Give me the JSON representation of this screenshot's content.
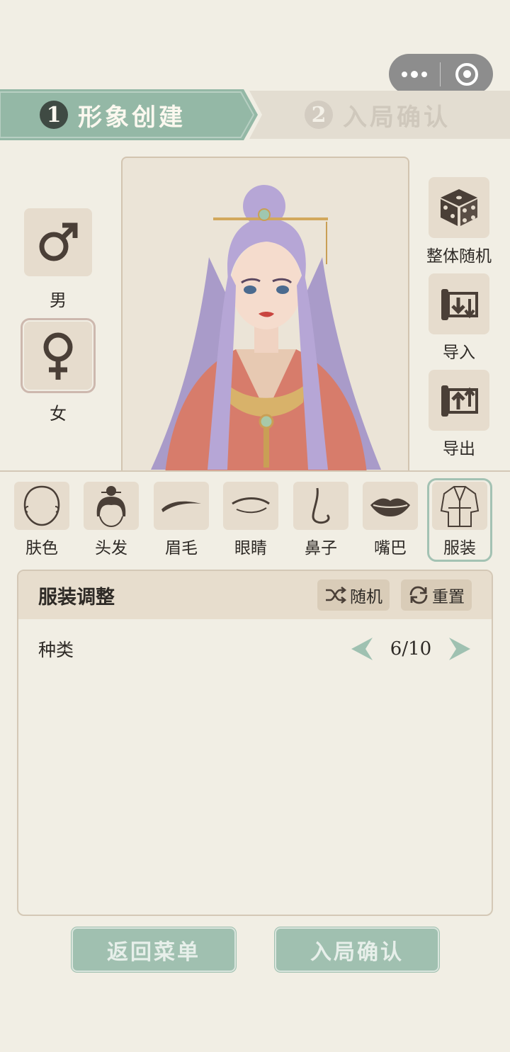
{
  "capsule": {
    "more_icon": "more-dots-icon",
    "close_icon": "target-circle-icon"
  },
  "steps": [
    {
      "number": "1",
      "label": "形象创建",
      "active": true
    },
    {
      "number": "2",
      "label": "入局确认",
      "active": false
    }
  ],
  "gender": {
    "male": {
      "label": "男",
      "icon": "male-symbol-icon"
    },
    "female": {
      "label": "女",
      "icon": "female-symbol-icon",
      "selected": true
    }
  },
  "actions": [
    {
      "label": "整体随机",
      "icon": "dice-icon"
    },
    {
      "label": "导入",
      "icon": "scroll-import-icon"
    },
    {
      "label": "导出",
      "icon": "scroll-export-icon"
    }
  ],
  "feature_tabs": [
    {
      "label": "肤色",
      "icon": "face-outline-icon"
    },
    {
      "label": "头发",
      "icon": "hair-bun-icon"
    },
    {
      "label": "眉毛",
      "icon": "eyebrow-icon"
    },
    {
      "label": "眼睛",
      "icon": "eye-icon"
    },
    {
      "label": "鼻子",
      "icon": "nose-icon"
    },
    {
      "label": "嘴巴",
      "icon": "lips-icon"
    },
    {
      "label": "服装",
      "icon": "robe-icon",
      "selected": true
    }
  ],
  "panel": {
    "title": "服装调整",
    "random_label": "随机",
    "reset_label": "重置",
    "rows": [
      {
        "label": "种类",
        "value": "6/10"
      }
    ]
  },
  "buttons": {
    "back": "返回菜单",
    "confirm": "入局确认"
  },
  "colors": {
    "accent": "#94b8a6",
    "background": "#f1eee4",
    "tile": "#e6dccd"
  }
}
